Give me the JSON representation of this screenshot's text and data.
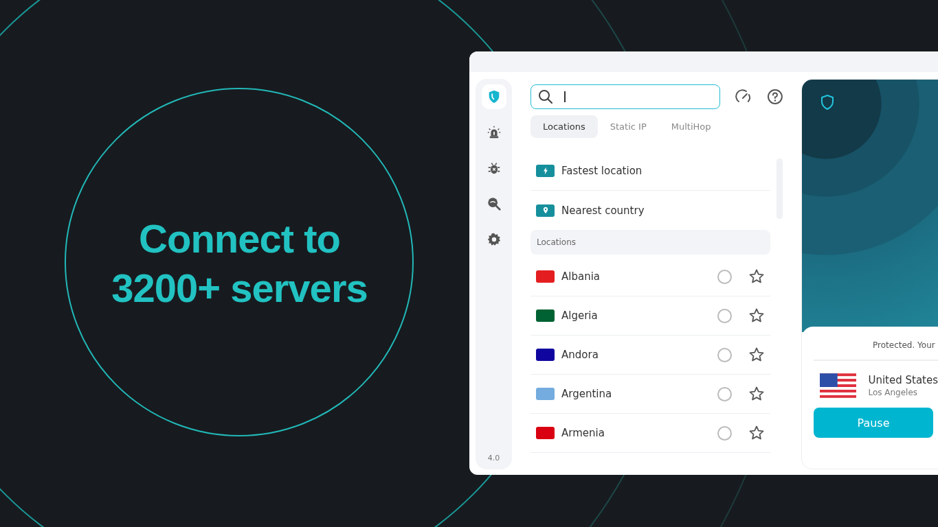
{
  "headline": {
    "lines": [
      "Connect to",
      "3200+ servers"
    ]
  },
  "sidebar": {
    "items": [
      {
        "kind": "shield",
        "selected": true
      },
      {
        "kind": "alarm",
        "selected": false
      },
      {
        "kind": "bug",
        "selected": false
      },
      {
        "kind": "search",
        "selected": false
      },
      {
        "kind": "gear",
        "selected": false
      }
    ],
    "version": "4.0"
  },
  "search": {
    "focused": true
  },
  "tabs": [
    {
      "label": "Locations",
      "selected": true
    },
    {
      "label": "Static IP",
      "selected": false
    },
    {
      "label": "MultiHop",
      "selected": false
    }
  ],
  "quick_options": [
    {
      "kind": "bolt",
      "label": "Fastest location"
    },
    {
      "kind": "pin",
      "label": "Nearest country"
    }
  ],
  "section_header": "Locations",
  "countries": [
    {
      "name": "Albania",
      "selected": false,
      "favorite": false,
      "color": "#e41e20"
    },
    {
      "name": "Algeria",
      "selected": false,
      "favorite": false,
      "color": "#006233"
    },
    {
      "name": "Andora",
      "selected": false,
      "favorite": false,
      "color": "#10069f"
    },
    {
      "name": "Argentina",
      "selected": false,
      "favorite": false,
      "color": "#74acdf"
    },
    {
      "name": "Armenia",
      "selected": false,
      "favorite": false,
      "color": "#d90012"
    }
  ],
  "connection": {
    "status": "Protected. Your",
    "country": "United States",
    "city": "Los Angeles",
    "button": "Pause"
  }
}
